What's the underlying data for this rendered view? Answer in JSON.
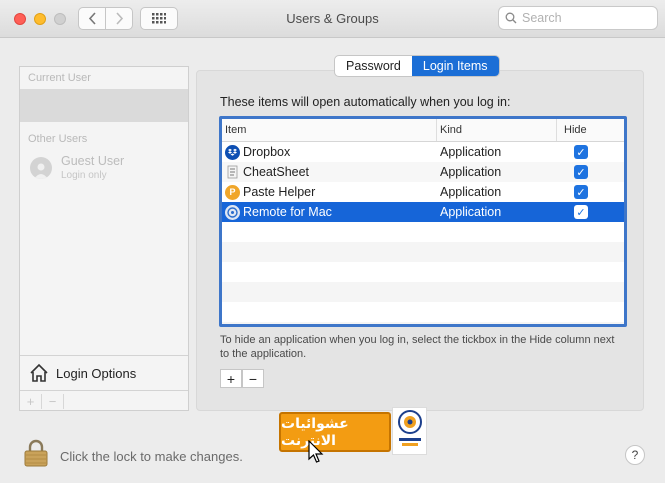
{
  "window": {
    "title": "Users & Groups"
  },
  "search": {
    "placeholder": "Search"
  },
  "sidebar": {
    "current_user_header": "Current User",
    "other_users_header": "Other Users",
    "guest": {
      "name": "Guest User",
      "sub": "Login only"
    },
    "login_options_label": "Login Options",
    "add_label": "+",
    "remove_label": "−"
  },
  "tabs": {
    "password": "Password",
    "login_items": "Login Items",
    "active": "Login Items"
  },
  "intro_text": "These items will open automatically when you log in:",
  "table": {
    "headers": {
      "item": "Item",
      "kind": "Kind",
      "hide": "Hide"
    },
    "rows": [
      {
        "name": "Dropbox",
        "kind": "Application",
        "hide": true,
        "icon": "dropbox-icon"
      },
      {
        "name": "CheatSheet",
        "kind": "Application",
        "hide": true,
        "icon": "cheatsheet-icon"
      },
      {
        "name": "Paste Helper",
        "kind": "Application",
        "hide": true,
        "icon": "paste-helper-icon"
      },
      {
        "name": "Remote for Mac",
        "kind": "Application",
        "hide": true,
        "icon": "remote-for-mac-icon",
        "selected": true
      }
    ]
  },
  "hint_text": "To hide an application when you log in, select the tickbox in the Hide column next to the application.",
  "buttons": {
    "add": "+",
    "remove": "−",
    "help": "?"
  },
  "lock_text": "Click the lock to make changes.",
  "watermark_text": "عشوائيات الانترنت",
  "colors": {
    "accent": "#1665d8",
    "watermark": "#f39c12"
  }
}
